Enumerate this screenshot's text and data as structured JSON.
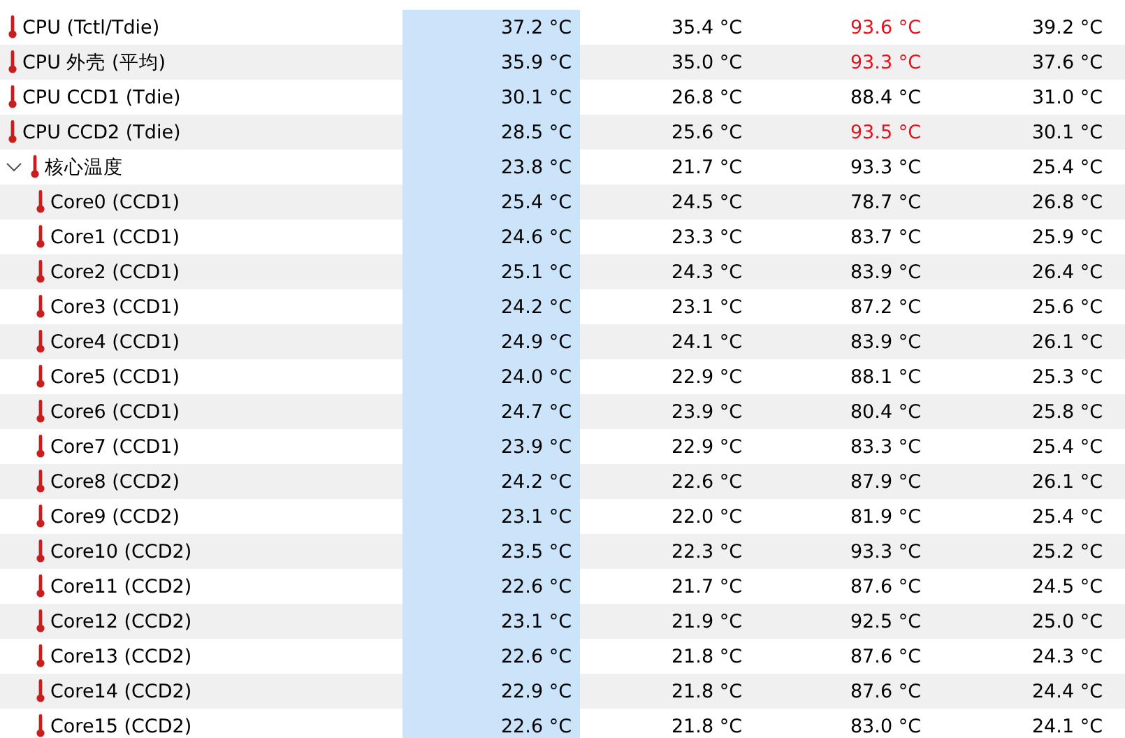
{
  "sensors": [
    {
      "name": "CPU (Tctl/Tdie)",
      "current": "37.2 °C",
      "min": "35.4 °C",
      "max": "93.6 °C",
      "avg": "39.2 °C",
      "alarm": true
    },
    {
      "name": "CPU 外壳 (平均)",
      "current": "35.9 °C",
      "min": "35.0 °C",
      "max": "93.3 °C",
      "avg": "37.6 °C",
      "alarm": true
    },
    {
      "name": "CPU CCD1 (Tdie)",
      "current": "30.1 °C",
      "min": "26.8 °C",
      "max": "88.4 °C",
      "avg": "31.0 °C",
      "alarm": false
    },
    {
      "name": "CPU CCD2 (Tdie)",
      "current": "28.5 °C",
      "min": "25.6 °C",
      "max": "93.5 °C",
      "avg": "30.1 °C",
      "alarm": true
    },
    {
      "name": "核心温度",
      "current": "23.8 °C",
      "min": "21.7 °C",
      "max": "93.3 °C",
      "avg": "25.4 °C",
      "alarm": false,
      "expanded": true,
      "children": [
        {
          "name": "Core0 (CCD1)",
          "current": "25.4 °C",
          "min": "24.5 °C",
          "max": "78.7 °C",
          "avg": "26.8 °C",
          "alarm": false
        },
        {
          "name": "Core1 (CCD1)",
          "current": "24.6 °C",
          "min": "23.3 °C",
          "max": "83.7 °C",
          "avg": "25.9 °C",
          "alarm": false
        },
        {
          "name": "Core2 (CCD1)",
          "current": "25.1 °C",
          "min": "24.3 °C",
          "max": "83.9 °C",
          "avg": "26.4 °C",
          "alarm": false
        },
        {
          "name": "Core3 (CCD1)",
          "current": "24.2 °C",
          "min": "23.1 °C",
          "max": "87.2 °C",
          "avg": "25.6 °C",
          "alarm": false
        },
        {
          "name": "Core4 (CCD1)",
          "current": "24.9 °C",
          "min": "24.1 °C",
          "max": "83.9 °C",
          "avg": "26.1 °C",
          "alarm": false
        },
        {
          "name": "Core5 (CCD1)",
          "current": "24.0 °C",
          "min": "22.9 °C",
          "max": "88.1 °C",
          "avg": "25.3 °C",
          "alarm": false
        },
        {
          "name": "Core6 (CCD1)",
          "current": "24.7 °C",
          "min": "23.9 °C",
          "max": "80.4 °C",
          "avg": "25.8 °C",
          "alarm": false
        },
        {
          "name": "Core7 (CCD1)",
          "current": "23.9 °C",
          "min": "22.9 °C",
          "max": "83.3 °C",
          "avg": "25.4 °C",
          "alarm": false
        },
        {
          "name": "Core8 (CCD2)",
          "current": "24.2 °C",
          "min": "22.6 °C",
          "max": "87.9 °C",
          "avg": "26.1 °C",
          "alarm": false
        },
        {
          "name": "Core9 (CCD2)",
          "current": "23.1 °C",
          "min": "22.0 °C",
          "max": "81.9 °C",
          "avg": "25.4 °C",
          "alarm": false
        },
        {
          "name": "Core10 (CCD2)",
          "current": "23.5 °C",
          "min": "22.3 °C",
          "max": "93.3 °C",
          "avg": "25.2 °C",
          "alarm": false
        },
        {
          "name": "Core11 (CCD2)",
          "current": "22.6 °C",
          "min": "21.7 °C",
          "max": "87.6 °C",
          "avg": "24.5 °C",
          "alarm": false
        },
        {
          "name": "Core12 (CCD2)",
          "current": "23.1 °C",
          "min": "21.9 °C",
          "max": "92.5 °C",
          "avg": "25.0 °C",
          "alarm": false
        },
        {
          "name": "Core13 (CCD2)",
          "current": "22.6 °C",
          "min": "21.8 °C",
          "max": "87.6 °C",
          "avg": "24.3 °C",
          "alarm": false
        },
        {
          "name": "Core14 (CCD2)",
          "current": "22.9 °C",
          "min": "21.8 °C",
          "max": "87.6 °C",
          "avg": "24.4 °C",
          "alarm": false
        },
        {
          "name": "Core15 (CCD2)",
          "current": "22.6 °C",
          "min": "21.8 °C",
          "max": "83.0 °C",
          "avg": "24.1 °C",
          "alarm": false
        }
      ]
    }
  ]
}
